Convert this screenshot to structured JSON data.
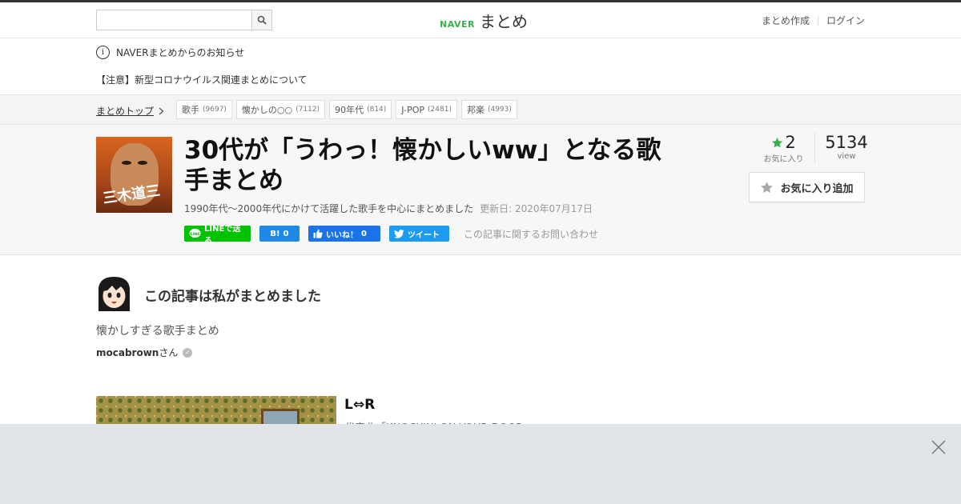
{
  "header": {
    "search_placeholder": "",
    "logo_brand": "NAVER",
    "logo_text": "まとめ",
    "links": [
      "まとめ作成",
      "ログイン"
    ]
  },
  "notice": {
    "title": "NAVERまとめからのお知らせ",
    "link": "【注意】新型コロナウイルス関連まとめについて"
  },
  "breadcrumb": {
    "top": "まとめトップ",
    "tags": [
      {
        "label": "歌手",
        "count": "(9697)"
      },
      {
        "label": "懐かしの○○",
        "count": "(7112)"
      },
      {
        "label": "90年代",
        "count": "(814)"
      },
      {
        "label": "J-POP",
        "count": "(2481)"
      },
      {
        "label": "邦楽",
        "count": "(4993)"
      }
    ]
  },
  "article": {
    "thumb_mark": "三木道三",
    "title": "30代が「うわっ！懐かしいww」となる歌手まとめ",
    "description": "1990年代～2000年代にかけて活躍した歌手を中心にまとめました",
    "updated": "更新日: 2020年07月17日",
    "favorites_count": "2",
    "favorites_label": "お気に入り",
    "views_count": "5134",
    "views_label": "view",
    "fav_button": "お気に入り追加"
  },
  "share": {
    "line": "LINEで送る",
    "hatena_label": "B!",
    "hatena_count": "0",
    "like_label": "いいね！",
    "like_count": "0",
    "tweet": "ツイート",
    "inquiry": "この記事に関するお問い合わせ"
  },
  "author": {
    "heading": "この記事は私がまとめました",
    "description": "懐かしすぎる歌手まとめ",
    "name": "mocabrown",
    "suffix": "さん"
  },
  "first_item": {
    "title": "L⇔R",
    "subtitle": "代表曲「KNOCKIN' ON YOUR DOOR"
  },
  "colors": {
    "naver_green": "#36b24a",
    "line_green": "#00c300",
    "hatena_blue": "#1e8ae6",
    "facebook_blue": "#1a73e8",
    "twitter_blue": "#1d9bf0",
    "star_green": "#36b24a"
  },
  "icons": [
    "search-icon",
    "chevron-right-icon",
    "info-icon",
    "star-icon",
    "verified-check-icon",
    "close-icon",
    "line-icon",
    "thumbs-up-icon",
    "twitter-bird-icon"
  ]
}
